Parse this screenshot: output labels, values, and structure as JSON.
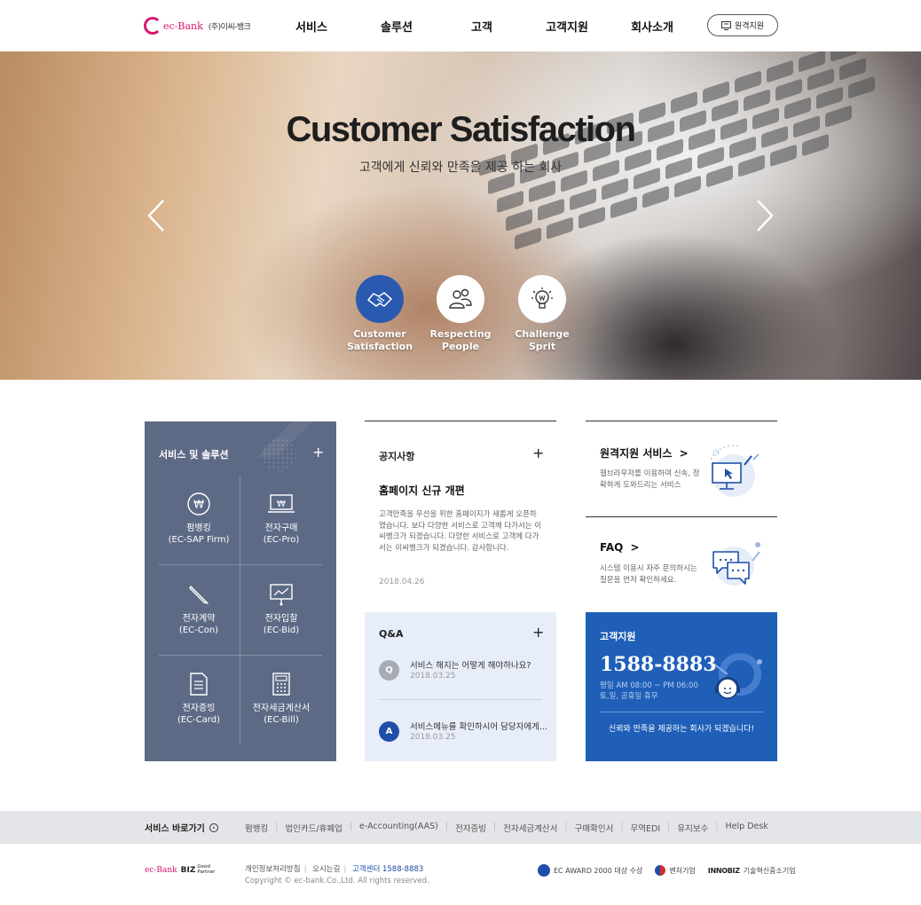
{
  "header": {
    "logo_text": "ec-Bank",
    "logo_sub": "(주)이씨-뱅크",
    "nav": [
      "서비스",
      "솔루션",
      "고객",
      "고객지원",
      "회사소개"
    ],
    "remote_button": "원격지원"
  },
  "hero": {
    "title": "Customer Satisfaction",
    "subtitle": "고객에게 신뢰와 만족을 제공 하는 회사",
    "values": [
      {
        "line1": "Customer",
        "line2": "Satisfaction",
        "icon": "handshake-icon"
      },
      {
        "line1": "Respecting",
        "line2": "People",
        "icon": "people-icon"
      },
      {
        "line1": "Challenge",
        "line2": "Sprit",
        "icon": "lightbulb-icon"
      }
    ]
  },
  "services": {
    "title": "서비스 및 솔루션",
    "plus": "+",
    "items": [
      {
        "name": "펌뱅킹",
        "code": "(EC-SAP Firm)",
        "icon": "won-coin-icon"
      },
      {
        "name": "전자구매",
        "code": "(EC-Pro)",
        "icon": "laptop-won-icon"
      },
      {
        "name": "전자계약",
        "code": "(EC-Con)",
        "icon": "pencil-icon"
      },
      {
        "name": "전자입찰",
        "code": "(EC-Bid)",
        "icon": "chart-board-icon"
      },
      {
        "name": "전자증빙",
        "code": "(EC-Card)",
        "icon": "document-icon"
      },
      {
        "name": "전자세금계산서",
        "code": "(EC-Bill)",
        "icon": "calculator-icon"
      }
    ]
  },
  "notice": {
    "title": "공지사항",
    "plus": "+",
    "headline": "홈페이지 신규 개편",
    "body": "고객만족을 우선을 위한 홈페이지가 새롭게 오픈하였습니다. 보다 다양한 서비스로 고객께 다가서는 이씨뱅크가 되겠습니다. 다양한 서비스로 고객께 다가서는 이씨뱅크가 되겠습니다. 감사합니다.",
    "date": "2018.04.26"
  },
  "qa": {
    "title": "Q&A",
    "plus": "+",
    "rows": [
      {
        "badge": "Q",
        "text": "서비스 해지는 어떻게 해야하나요?",
        "date": "2018.03.25",
        "color": "#a7abb3"
      },
      {
        "badge": "A",
        "text": "서비스메뉴를 확인하시어 담당자에게...",
        "date": "2018.03.25",
        "color": "#1f4fa8"
      }
    ]
  },
  "remote_service": {
    "title": "원격지원 서비스",
    "arrow": ">",
    "desc": "웹브라우저를 이용하여 신속, 정확하게 도와드리는 서비스"
  },
  "faq": {
    "title": "FAQ",
    "arrow": ">",
    "desc": "시스템 이용시 자주 문의하시는 질문을 먼저 확인하세요."
  },
  "customer_support": {
    "title": "고객지원",
    "phone": "1588-8883",
    "hours1": "평일 AM 08:00 ~ PM 06:00",
    "hours2": "토,일, 공휴일 휴무",
    "slogan": "신뢰와 만족을 제공하는 회사가 되겠습니다!"
  },
  "quick": {
    "title": "서비스 바로가기",
    "title_icon": "›",
    "links": [
      "펌뱅킹",
      "법인카드/휴폐업",
      "e-Accounting(AAS)",
      "전자증빙",
      "전자세금계산서",
      "구매확인서",
      "무역EDI",
      "유지보수",
      "Help Desk"
    ]
  },
  "footer": {
    "logo_a": "ec-Bank",
    "logo_b": "BIZ",
    "logo_c1": "Good",
    "logo_c2": "Partner",
    "privacy": "개인정보처리방침",
    "directions": "오시는길",
    "center": "고객센터 1588-8883",
    "copyright": "Copyright © ec-bank.Co.,Ltd. All rights reserved.",
    "award": "EC AWARD 2000 대상 수상",
    "venture": "벤처기업",
    "innobiz_logo": "INNOBIZ",
    "innobiz": "기술혁신중소기업"
  },
  "colors": {
    "brand": "#d5186f",
    "primary_blue": "#1f5fb8",
    "service_panel": "#5d6a86",
    "qa_bg": "#e8eef9"
  }
}
